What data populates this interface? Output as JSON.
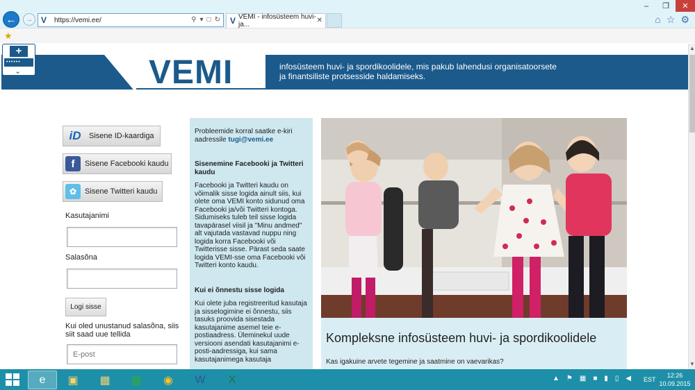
{
  "browser": {
    "url": "https://vemi.ee/",
    "tab_title": "VEMI - infosüsteem huvi- ja...",
    "site_icon": "V"
  },
  "header": {
    "logo": "VEMI",
    "badge_text": "••••••",
    "tagline_line1": "infosüsteem huvi- ja spordikoolidele, mis pakub lahendusi organisatoorsete",
    "tagline_line2": "ja finantsiliste protsesside haldamiseks."
  },
  "login": {
    "id_button": "Sisene ID-kaardiga",
    "id_icon": "iD",
    "facebook_button": "Sisene Facebooki kaudu",
    "twitter_button": "Sisene Twitteri kaudu",
    "username_label": "Kasutajanimi",
    "password_label": "Salasõna",
    "login_button": "Logi sisse",
    "forgot_text": "Kui oled unustanud salasõna, siis siit saad uue tellida",
    "email_placeholder": "E-post"
  },
  "info": {
    "intro": "Probleemide korral saatke e-kiri aadressile",
    "email": "tugi@vemi.ee",
    "heading1": "Sisenemine Facebooki ja Twitteri kaudu",
    "para1": "Facebooki ja Twitteri kaudu on võimalik sisse logida ainult siis, kui olete oma VEMI konto sidunud oma Facebooki ja/või Twitteri kontoga. Sidumiseks tuleb teil sisse logida tavapärasel viisil ja \"Minu andmed\" alt vajutada vastavad nuppu ning logida korra Facebooki või Twitterisse sisse. Pärast seda saate logida VEMI-sse oma Facebooki või Twitteri konto kaudu.",
    "heading2": "Kui ei õnnestu sisse logida",
    "para2": "Kui olete juba registreeritud kasutaja ja sisselogimine ei õnnestu, siis tasuks proovida sisestada kasutajanime asemel teie e-postiaadress. Üleminekul uude versiooni asendati kasutajanimi e-posti-aadressiga, kui sama kasutajanimega kasutaja"
  },
  "content": {
    "title": "Kompleksne infosüsteem huvi- ja spordikoolidele",
    "subtitle": "Kas igakuine arvete tegemine ja saatmine on vaevarikas?"
  },
  "taskbar": {
    "lang": "EST",
    "time": "12:26",
    "date": "10.09.2015"
  },
  "colors": {
    "brand": "#1b5a8b",
    "info_bg": "#cfe8f0",
    "taskbar": "#1e8fa8"
  }
}
